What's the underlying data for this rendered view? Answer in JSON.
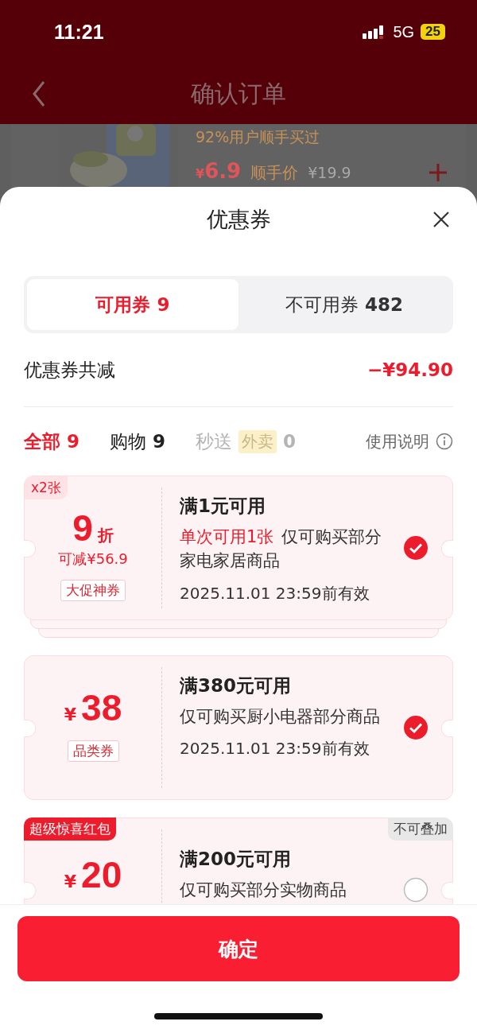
{
  "status_bar": {
    "time": "11:21",
    "network": "5G",
    "battery": "25"
  },
  "background_page": {
    "title": "确认订单",
    "product": {
      "kind": "picture",
      "promo": "92%用户顺手买过",
      "price_symbol": "¥",
      "price": "6.9",
      "price_label": "顺手价",
      "original_price": "¥19.9"
    }
  },
  "sheet": {
    "title": "优惠券",
    "tabs": [
      {
        "label": "可用券",
        "count": "9",
        "selected": true
      },
      {
        "label": "不可用券",
        "count": "482",
        "selected": false
      }
    ],
    "summary": {
      "label": "优惠券共减",
      "amount": "−¥94.90"
    },
    "filters": [
      {
        "label": "全部",
        "count": "9",
        "selected": true,
        "disabled": false
      },
      {
        "label": "购物",
        "count": "9",
        "selected": false,
        "disabled": false
      },
      {
        "label": "秒送",
        "tag": "外卖",
        "count": "0",
        "selected": false,
        "disabled": true
      }
    ],
    "help_link": "使用说明",
    "coupons": [
      {
        "kind": "discount",
        "corner_badge": "x2张",
        "value": "9",
        "unit": "折",
        "saving": "可减¥56.9",
        "tag": "大促神券",
        "condition": "满1元可用",
        "highlight": "单次可用1张",
        "description": "仅可购买部分家电家居商品",
        "expiry": "2025.11.01 23:59前有效",
        "selected": true,
        "stacked": true
      },
      {
        "kind": "amount",
        "currency": "¥",
        "value": "38",
        "tag": "品类券",
        "condition": "满380元可用",
        "description": "仅可购买厨小电器部分商品",
        "expiry": "2025.11.01 23:59前有效",
        "selected": true,
        "stacked": false
      },
      {
        "kind": "amount",
        "ribbon": "超级惊喜红包",
        "note": "不可叠加",
        "currency": "¥",
        "value": "20",
        "condition": "满200元可用",
        "description": "仅可购买部分实物商品",
        "selected": false,
        "stacked": false
      }
    ],
    "confirm_button": "确定"
  }
}
